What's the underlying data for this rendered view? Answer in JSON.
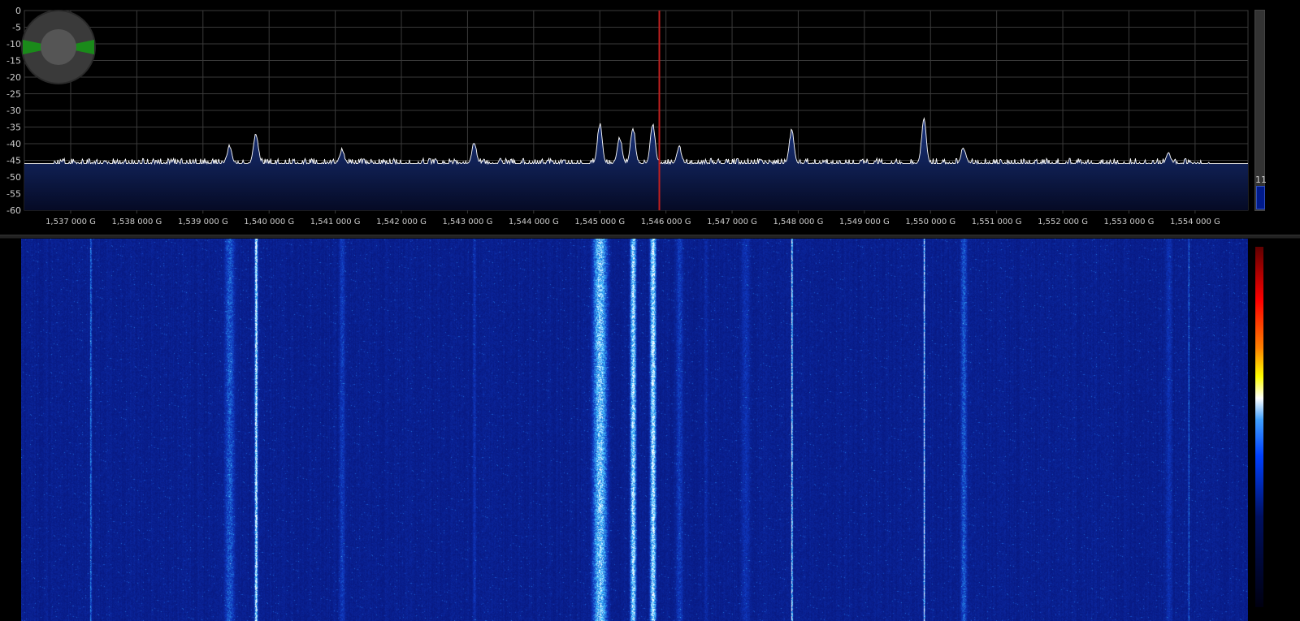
{
  "spectrum": {
    "db_ticks": [
      "0",
      "-5",
      "-10",
      "-15",
      "-20",
      "-25",
      "-30",
      "-35",
      "-40",
      "-45",
      "-50",
      "-55",
      "-60"
    ],
    "freq_ticks": [
      "1,537 000 G",
      "1,538 000 G",
      "1,539 000 G",
      "1,540 000 G",
      "1,541 000 G",
      "1,542 000 G",
      "1,543 000 G",
      "1,544 000 G",
      "1,545 000 G",
      "1,546 000 G",
      "1,547 000 G",
      "1,548 000 G",
      "1,549 000 G",
      "1,550 000 G",
      "1,551 000 G",
      "1,552 000 G",
      "1,553 000 G",
      "1,554 000 G"
    ],
    "freq_values_ghz": [
      1.537,
      1.538,
      1.539,
      1.54,
      1.541,
      1.542,
      1.543,
      1.544,
      1.545,
      1.546,
      1.547,
      1.548,
      1.549,
      1.55,
      1.551,
      1.552,
      1.553,
      1.554
    ],
    "range_ghz": [
      1.5363,
      1.5548
    ],
    "db_range": [
      -60,
      0
    ],
    "noise_floor_db": -46,
    "center_marker_ghz": 1.5459,
    "peaks": [
      {
        "f": 1.5394,
        "db": -41
      },
      {
        "f": 1.5398,
        "db": -37
      },
      {
        "f": 1.5411,
        "db": -42
      },
      {
        "f": 1.5431,
        "db": -40
      },
      {
        "f": 1.545,
        "db": -34
      },
      {
        "f": 1.5453,
        "db": -38
      },
      {
        "f": 1.5455,
        "db": -35
      },
      {
        "f": 1.5458,
        "db": -34
      },
      {
        "f": 1.5462,
        "db": -41
      },
      {
        "f": 1.5479,
        "db": -36
      },
      {
        "f": 1.5499,
        "db": -33
      },
      {
        "f": 1.5505,
        "db": -41
      },
      {
        "f": 1.5536,
        "db": -43
      }
    ],
    "colors": {
      "background": "#000000",
      "grid": "#3a3a3a",
      "trace": "#ffffff",
      "fill": "#0a1a55",
      "marker": "#c02020",
      "text": "#cccccc"
    }
  },
  "level": {
    "value_label": "11",
    "fill_fraction": 0.11
  },
  "waterfall": {
    "colors": {
      "base": "#0a1a9a",
      "mid": "#2050ff",
      "high": "#ffffff"
    }
  },
  "icons": {
    "zoom": "zoom-knob-icon"
  }
}
